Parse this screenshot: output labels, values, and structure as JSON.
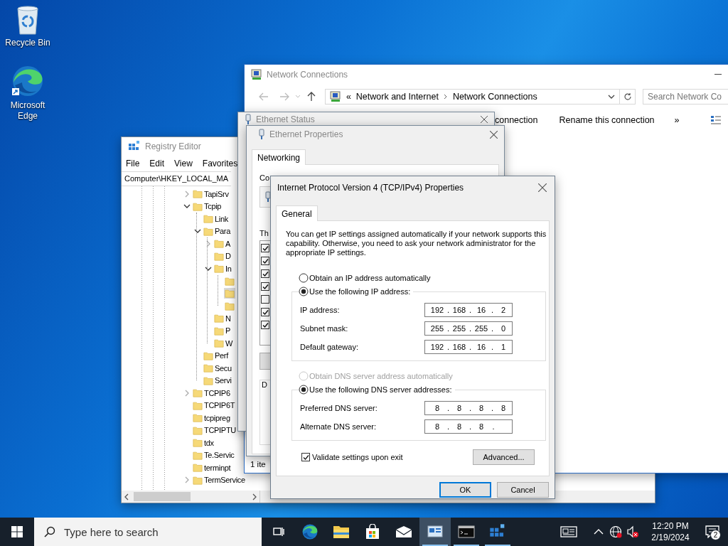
{
  "desktop_icons": [
    {
      "kind": "recycle",
      "label": "Recycle Bin"
    },
    {
      "kind": "edge",
      "label": "Microsoft Edge"
    }
  ],
  "registry_editor": {
    "title": "Registry Editor",
    "menu": [
      "File",
      "Edit",
      "View",
      "Favorites"
    ],
    "address": "Computer\\HKEY_LOCAL_MA",
    "tree": [
      {
        "label": "TapiSrv",
        "expanded": false
      },
      {
        "label": "Tcpip",
        "expanded": true,
        "children": [
          {
            "label": "Link"
          },
          {
            "label": "Para",
            "expanded": true,
            "children": [
              {
                "label": "A",
                "expanded": false
              },
              {
                "label": "D"
              },
              {
                "label": "In",
                "expanded": true,
                "children": [
                  {
                    "selected": false
                  },
                  {
                    "selected": true
                  },
                  {
                    "selected": false
                  }
                ]
              },
              {
                "label": "N"
              },
              {
                "label": "P"
              },
              {
                "label": "W"
              }
            ]
          },
          {
            "label": "Perf"
          },
          {
            "label": "Secu"
          },
          {
            "label": "Servi"
          }
        ]
      },
      {
        "label": "TCPIP6",
        "expanded": false
      },
      {
        "label": "TCPIP6T"
      },
      {
        "label": "tcpipreg"
      },
      {
        "label": "TCPIPTU"
      },
      {
        "label": "tdx"
      },
      {
        "label": "Te.Servic"
      },
      {
        "label": "terminpt"
      },
      {
        "label": "TermService",
        "expanded": false
      }
    ]
  },
  "network_connections": {
    "title": "Network Connections",
    "breadcrumb_prefix": "«",
    "breadcrumb": [
      "Network and Internet",
      "Network Connections"
    ],
    "search": {
      "placeholder": "Search Network Co"
    },
    "commands": [
      "connection",
      "Rename this connection"
    ],
    "more": "»",
    "status": "1 ite"
  },
  "ethernet_status": {
    "title": "Ethernet Status"
  },
  "ethernet_properties": {
    "title": "Ethernet Properties",
    "tabs": [
      {
        "label": "Networking",
        "selected": true
      }
    ],
    "connect_label": "Co",
    "components_label": "Th",
    "components": [
      {
        "checked": true
      },
      {
        "checked": true
      },
      {
        "checked": true
      },
      {
        "checked": true
      },
      {
        "checked": false
      },
      {
        "checked": true
      },
      {
        "checked": true
      }
    ],
    "description_label": "D"
  },
  "tcp_ipv4_properties": {
    "title": "Internet Protocol Version 4 (TCP/IPv4) Properties",
    "tabs": [
      {
        "label": "General",
        "selected": true
      }
    ],
    "intro": "You can get IP settings assigned automatically if your network supports this capability. Otherwise, you need to ask your network administrator for the appropriate IP settings.",
    "ip_mode": [
      {
        "label": "Obtain an IP address automatically",
        "selected": false
      },
      {
        "label": "Use the following IP address:",
        "selected": true
      }
    ],
    "ip_fields": [
      {
        "label": "IP address:",
        "value": "192 . 168 . 16 . 2"
      },
      {
        "label": "Subnet mask:",
        "value": "255 . 255 . 255 . 0"
      },
      {
        "label": "Default gateway:",
        "value": "192 . 168 . 16 . 1"
      }
    ],
    "dns_mode": [
      {
        "label": "Obtain DNS server address automatically",
        "selected": false,
        "disabled": true
      },
      {
        "label": "Use the following DNS server addresses:",
        "selected": true,
        "disabled": false
      }
    ],
    "dns_fields": [
      {
        "label": "Preferred DNS server:",
        "value": "8 . 8 . 8 . 8"
      },
      {
        "label": "Alternate DNS server:",
        "value": "8 . 8 . 8 ."
      }
    ],
    "validate": {
      "label": "Validate settings upon exit",
      "checked": true
    },
    "advanced_button": "Advanced...",
    "buttons": [
      {
        "label": "OK",
        "default": true
      },
      {
        "label": "Cancel",
        "default": false
      }
    ]
  },
  "taskbar": {
    "search": {
      "placeholder": "Type here to search"
    },
    "apps": [
      {
        "kind": "task-view",
        "running": false,
        "selected": false
      },
      {
        "kind": "edge",
        "running": false,
        "selected": false
      },
      {
        "kind": "explorer",
        "running": false,
        "selected": false
      },
      {
        "kind": "store",
        "running": false,
        "selected": false
      },
      {
        "kind": "mail",
        "running": false,
        "selected": false
      },
      {
        "kind": "network",
        "running": true,
        "selected": true
      },
      {
        "kind": "terminal",
        "running": true,
        "selected": false
      },
      {
        "kind": "registry",
        "running": true,
        "selected": false
      }
    ],
    "tray": [
      {
        "kind": "news"
      },
      {
        "kind": "chevron"
      },
      {
        "kind": "network"
      },
      {
        "kind": "volume-muted"
      }
    ],
    "clock": {
      "time": "12:20 PM",
      "date": "2/19/2024"
    },
    "notifications": {
      "count": "2"
    }
  }
}
